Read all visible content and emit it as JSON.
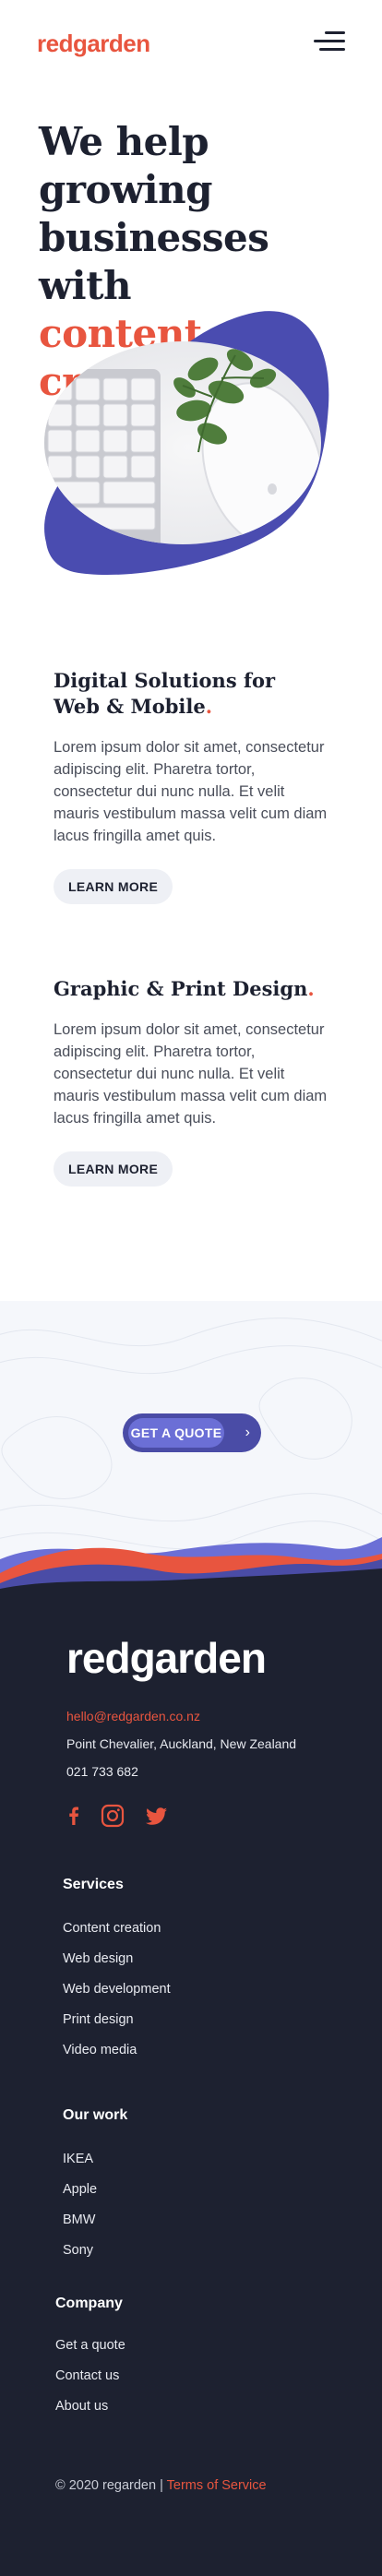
{
  "header": {
    "logo": "redgarden",
    "menu_icon": "hamburger-menu-icon"
  },
  "hero": {
    "title_line1": "We help growing",
    "title_line2": "businesses with",
    "title_accent": "content creation",
    "image": "keyboard-mouse-plant-photo"
  },
  "services": [
    {
      "title": "Digital Solutions for Web & Mobile",
      "title_line1": "Digital Solutions for",
      "title_line2": "Web & Mobile",
      "dot": ".",
      "text": "Lorem ipsum dolor sit amet, consectetur adipiscing elit. Pharetra tortor, consectetur dui nunc nulla. Et velit mauris vestibulum massa velit cum diam lacus fringilla amet quis.",
      "button": "LEARN MORE"
    },
    {
      "title": "Graphic & Print Design",
      "dot": ".",
      "text": "Lorem ipsum dolor sit amet, consectetur adipiscing elit. Pharetra tortor, consectetur dui nunc nulla. Et velit mauris vestibulum massa velit cum diam lacus fringilla amet quis.",
      "button": "LEARN MORE"
    }
  ],
  "quote": {
    "button": "GET A QUOTE",
    "chevron": "›"
  },
  "footer": {
    "logo": "redgarden",
    "email": "hello@redgarden.co.nz",
    "address": "Point Chevalier, Auckland, New Zealand",
    "phone": "021 733 682",
    "social_icons": [
      "facebook-icon",
      "instagram-icon",
      "twitter-icon"
    ],
    "services_heading": "Services",
    "services": [
      "Content creation",
      "Web design",
      "Web development",
      "Print design",
      "Video media"
    ],
    "work_heading": "Our work",
    "work": [
      "IKEA",
      "Apple",
      "BMW",
      "Sony"
    ],
    "company_heading": "Company",
    "company": [
      "Get a quote",
      "Contact us",
      "About us"
    ],
    "copyright": "© 2020 regarden |",
    "terms": "Terms of Service"
  },
  "colors": {
    "accent": "#e8553f",
    "dark": "#1d2130",
    "purple": "#4a4ca6",
    "purple_light": "#6b6fd6"
  }
}
